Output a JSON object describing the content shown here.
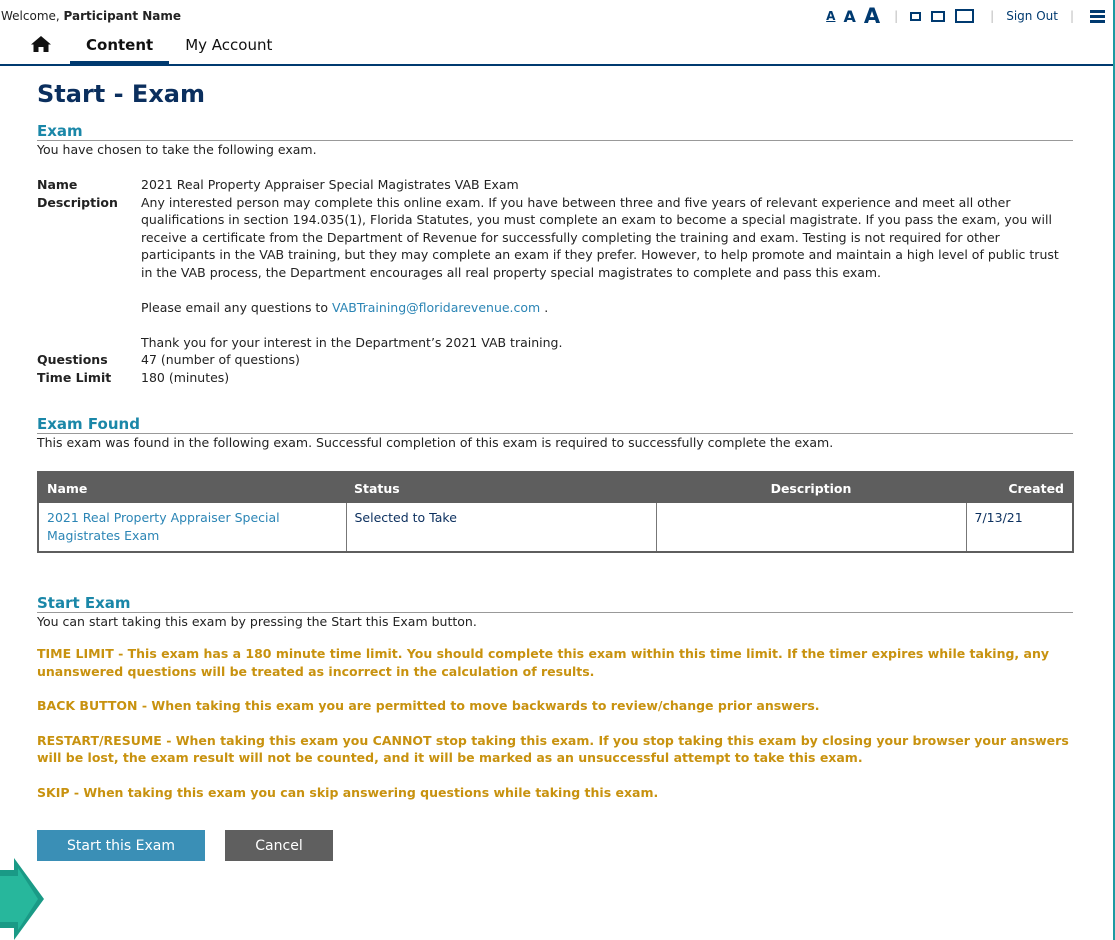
{
  "topbar": {
    "welcome_prefix": "Welcome, ",
    "user_name": "Participant Name",
    "font_small": "A",
    "font_medium": "A",
    "font_large": "A",
    "sign_out": "Sign Out"
  },
  "nav": {
    "tabs": [
      {
        "label": "Content",
        "active": true
      },
      {
        "label": "My Account",
        "active": false
      }
    ]
  },
  "page_title": "Start - Exam",
  "exam": {
    "heading": "Exam",
    "intro": "You have chosen to take the following exam.",
    "name_label": "Name",
    "name": "2021 Real Property Appraiser Special Magistrates VAB Exam",
    "description_label": "Description",
    "description": "Any interested person may complete this online exam. If you have between three and five years of relevant experience and meet all other qualifications in section 194.035(1), Florida Statutes, you must complete an exam to become a special magistrate. If you pass the exam, you will receive a certificate from the Department of Revenue for successfully completing the training and exam. Testing is not required for other participants in the VAB training, but they may complete an exam if they prefer. However, to help promote and maintain a high level of public trust in the VAB process, the Department encourages all real property special magistrates to complete and pass this exam.",
    "email_prefix": "Please email any questions to ",
    "email": "VABTraining@floridarevenue.com",
    "email_suffix": " .",
    "thanks": "Thank you for your interest in the Department’s 2021 VAB training.",
    "questions_label": "Questions",
    "questions": "47 (number of questions)",
    "time_limit_label": "Time Limit",
    "time_limit": "180 (minutes)"
  },
  "exam_found": {
    "heading": "Exam Found",
    "intro": "This exam was found in the following exam. Successful completion of this exam is required to successfully complete the exam.",
    "columns": [
      "Name",
      "Status",
      "Description",
      "Created"
    ],
    "rows": [
      {
        "name": "2021 Real Property Appraiser Special Magistrates Exam",
        "status": "Selected to Take",
        "description": "",
        "created": "7/13/21"
      }
    ]
  },
  "start_exam": {
    "heading": "Start Exam",
    "intro": "You can start taking this exam by pressing the Start this Exam button.",
    "warnings": [
      "TIME LIMIT - This exam has a 180 minute time limit. You should complete this exam within this time limit. If the timer expires while taking, any unanswered questions will be treated as incorrect in the calculation of results.",
      "BACK BUTTON - When taking this exam you are permitted to move backwards to review/change prior answers.",
      "RESTART/RESUME - When taking this exam you CANNOT stop taking this exam. If you stop taking this exam by closing your browser your answers will be lost, the exam result will not be counted, and it will be marked as an unsuccessful attempt to take this exam.",
      "SKIP - When taking this exam you can skip answering questions while taking this exam."
    ],
    "start_button": "Start this Exam",
    "cancel_button": "Cancel"
  },
  "colors": {
    "navy": "#0b2f5e",
    "heading_teal": "#1a87a8",
    "warning": "#c8920f",
    "start_button": "#3a8fb6",
    "cancel_button": "#5f5f5f",
    "side_accent": "#1d9aa2"
  },
  "icons": {
    "home": "home-icon",
    "menu": "hamburger-menu-icon",
    "layout": "layout-width-icon",
    "pointer": "arrow-pointer-icon"
  }
}
